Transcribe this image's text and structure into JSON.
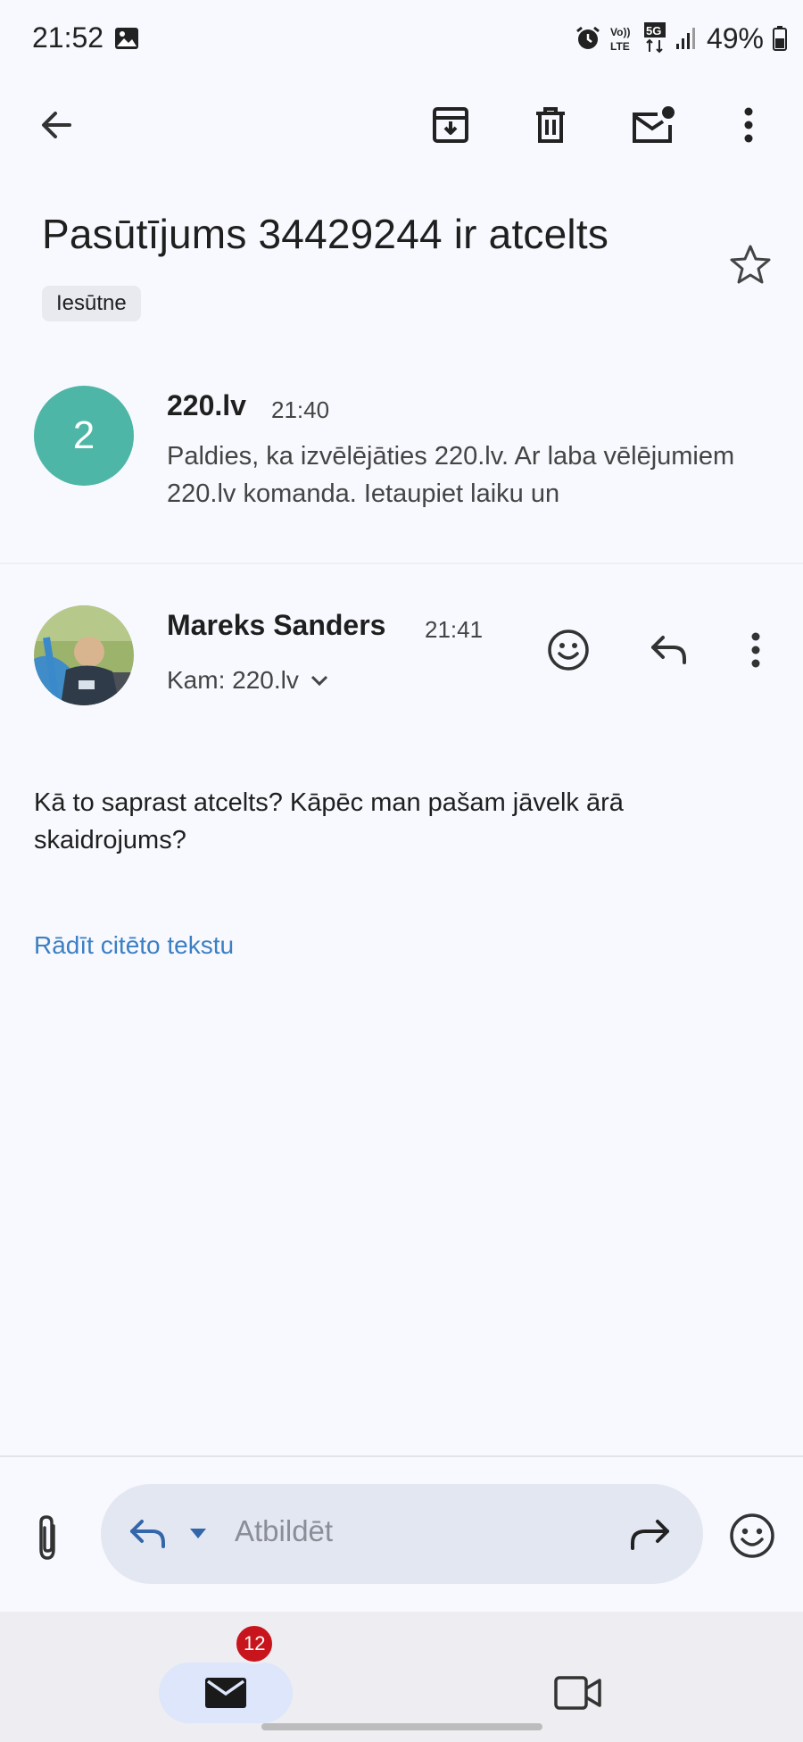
{
  "status_bar": {
    "time": "21:52",
    "battery": "49%",
    "network_labels": [
      "Vo)) LTE",
      "5G"
    ]
  },
  "toolbar": {
    "back": "arrow-back-icon",
    "archive": "archive-icon",
    "delete": "delete-icon",
    "mark_unread": "mark-unread-icon",
    "more": "more-vert-icon"
  },
  "email": {
    "subject": "Pasūtījums 34429244 ir atcelts",
    "label": "Iesūtne",
    "messages": [
      {
        "avatar_text": "2",
        "avatar_color": "#4db6a6",
        "sender": "220.lv",
        "time": "21:40",
        "snippet": "Paldies, ka izvēlējāties 220.lv. Ar laba vēlējumiem 220.lv komanda. Ietaupiet laiku un"
      },
      {
        "sender": "Mareks Sanders",
        "time": "21:41",
        "recipient": "Kam: 220.lv",
        "body": "Kā to saprast atcelts? Kāpēc man pašam jāvelk ārā skaidrojums?",
        "show_quoted": "Rādīt citēto tekstu"
      }
    ]
  },
  "reply_bar": {
    "placeholder": "Atbildēt"
  },
  "bottom_nav": {
    "mail_badge": "12"
  },
  "colors": {
    "background": "#f8f9fe",
    "link": "#3b7fc4",
    "badge": "#c8141c",
    "avatar": "#4db6a6"
  }
}
